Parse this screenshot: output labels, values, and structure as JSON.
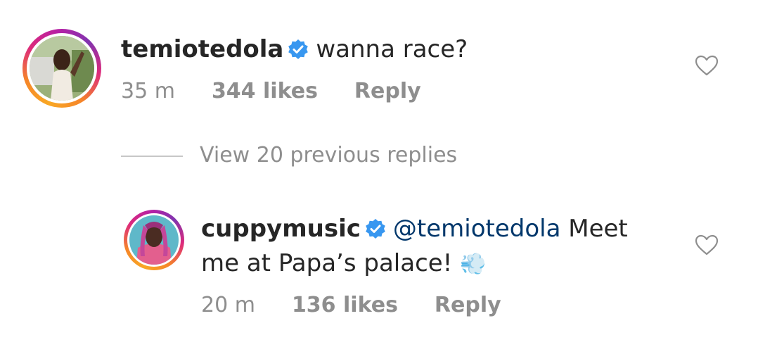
{
  "comments": [
    {
      "username": "temiotedola",
      "text": "wanna race?",
      "time": "35 m",
      "likes": "344 likes",
      "reply_label": "Reply"
    },
    {
      "username": "cuppymusic",
      "mention": "@temiotedola",
      "text_line1": "Meet",
      "text_line2": "me at Papa’s palace!",
      "emoji": "💨",
      "time": "20 m",
      "likes": "136 likes",
      "reply_label": "Reply"
    }
  ],
  "view_replies_label": "View 20 previous replies",
  "colors": {
    "verified": "#3897f0",
    "mention": "#00376b",
    "meta": "#8e8e8e"
  },
  "icons": [
    "verified-badge-icon",
    "heart-outline-icon",
    "dash-emoji"
  ]
}
